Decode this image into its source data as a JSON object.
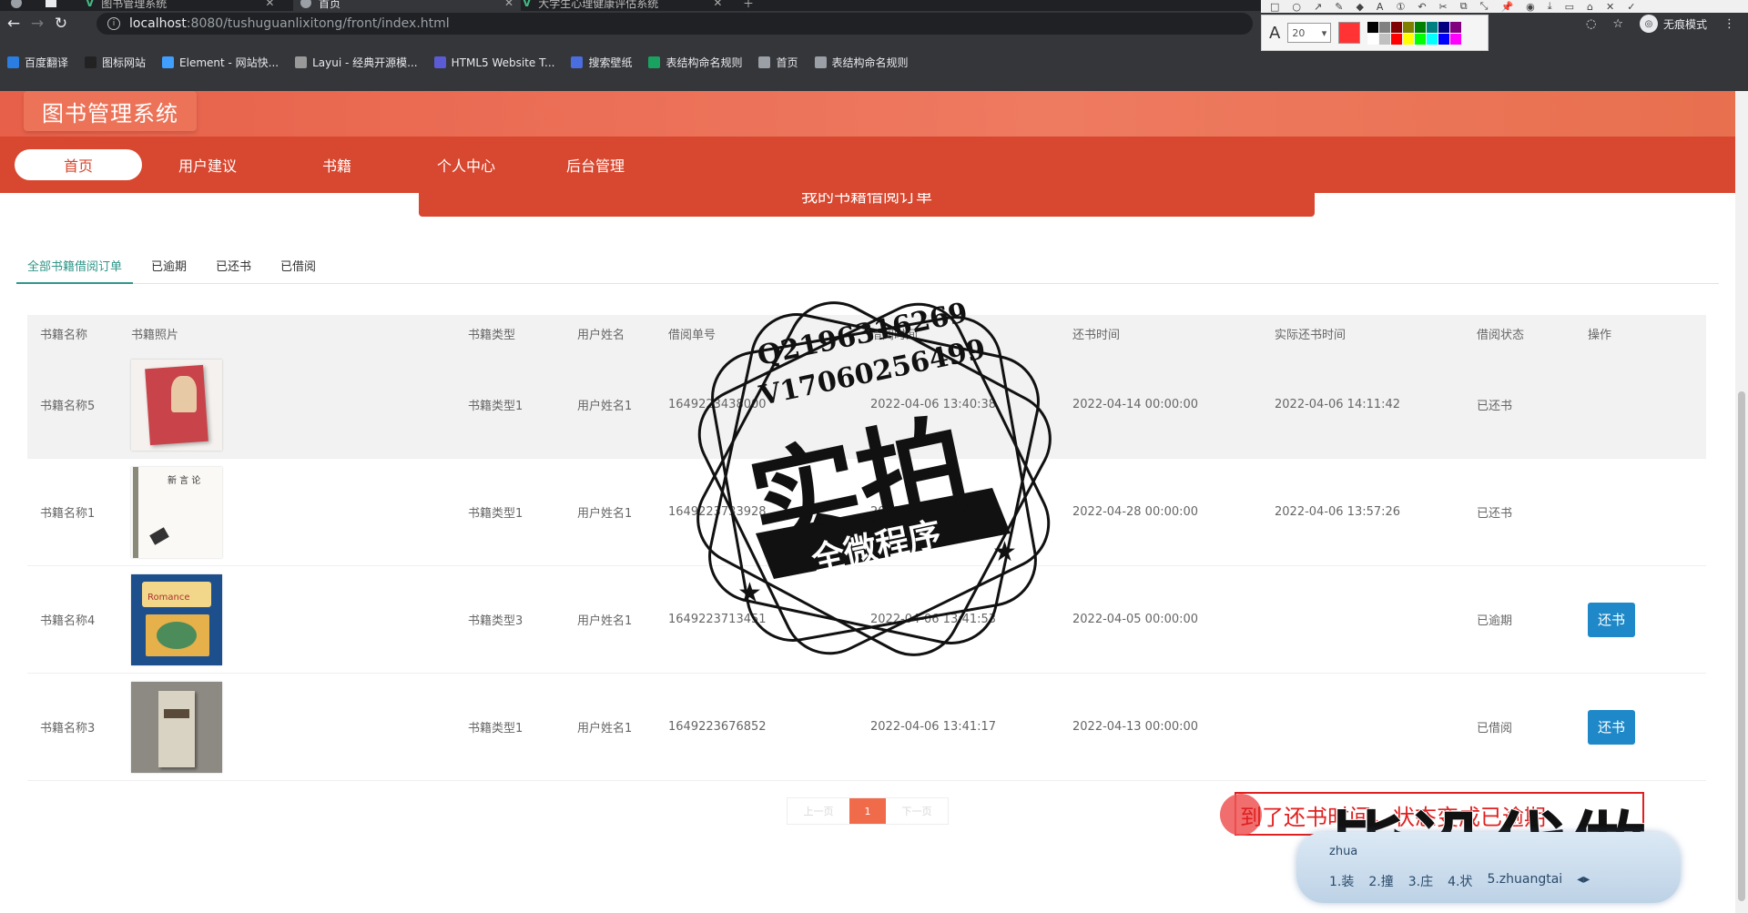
{
  "browser": {
    "tabs": [
      {
        "title": "图书管理系统",
        "active": false,
        "icon": "vue-icon"
      },
      {
        "title": "首页",
        "active": true,
        "icon": "globe-icon"
      },
      {
        "title": "大学生心理健康评估系统",
        "active": false,
        "icon": "vue-icon"
      }
    ],
    "url_host": "localhost",
    "url_path": ":8080/tushuguanlixitong/front/index.html",
    "incognito_label": "无痕模式",
    "bookmarks": [
      {
        "label": "百度翻译",
        "color": "#2a7de1"
      },
      {
        "label": "图标网站",
        "color": "#222222"
      },
      {
        "label": "Element - 网站快...",
        "color": "#409eff"
      },
      {
        "label": "Layui - 经典开源模...",
        "color": "#999999"
      },
      {
        "label": "HTML5 Website T...",
        "color": "#5b5bd6"
      },
      {
        "label": "搜索壁纸",
        "color": "#4a6ee0"
      },
      {
        "label": "表结构命名规则",
        "color": "#1aa260"
      },
      {
        "label": "首页",
        "color": "#9aa0a6"
      },
      {
        "label": "表结构命名规则",
        "color": "#9aa0a6"
      }
    ]
  },
  "annot_tool": {
    "font_size": "20",
    "current_color": "#ff3333",
    "palette": [
      "#000000",
      "#808080",
      "#800000",
      "#808000",
      "#008000",
      "#008080",
      "#000080",
      "#800080",
      "#ffffff",
      "#c0c0c0",
      "#ff0000",
      "#ffff00",
      "#00ff00",
      "#00ffff",
      "#0000ff",
      "#ff00ff"
    ]
  },
  "site": {
    "title": "图书管理系统",
    "nav": [
      {
        "label": "首页",
        "active": true
      },
      {
        "label": "用户建议",
        "active": false
      },
      {
        "label": "书籍",
        "active": false
      },
      {
        "label": "个人中心",
        "active": false
      },
      {
        "label": "后台管理",
        "active": false
      }
    ],
    "banner": "我的书籍借阅订单",
    "accent": "#d8472f"
  },
  "filter_tabs": [
    {
      "label": "全部书籍借阅订单",
      "active": true
    },
    {
      "label": "已逾期",
      "active": false
    },
    {
      "label": "已还书",
      "active": false
    },
    {
      "label": "已借阅",
      "active": false
    }
  ],
  "table": {
    "headers": [
      "书籍名称",
      "书籍照片",
      "书籍类型",
      "用户姓名",
      "借阅单号",
      "借阅时间",
      "还书时间",
      "实际还书时间",
      "借阅状态",
      "操作"
    ],
    "rows": [
      {
        "name": "书籍名称5",
        "type": "书籍类型1",
        "user": "用户姓名1",
        "order": "1649223438000",
        "borrow": "2022-04-06 13:40:38",
        "due": "2022-04-14 00:00:00",
        "actual": "2022-04-06 14:11:42",
        "status": "已还书",
        "action": "",
        "cover": "cover-red"
      },
      {
        "name": "书籍名称1",
        "type": "书籍类型1",
        "user": "用户姓名1",
        "order": "1649223733928",
        "borrow": "2022-04-06 13:42:14",
        "due": "2022-04-28 00:00:00",
        "actual": "2022-04-06 13:57:26",
        "status": "已还书",
        "action": "",
        "cover": "cover-white"
      },
      {
        "name": "书籍名称4",
        "type": "书籍类型3",
        "user": "用户姓名1",
        "order": "1649223713451",
        "borrow": "2022-04-06 13:41:53",
        "due": "2022-04-05 00:00:00",
        "actual": "",
        "status": "已逾期",
        "action": "还书",
        "cover": "cover-blue"
      },
      {
        "name": "书籍名称3",
        "type": "书籍类型1",
        "user": "用户姓名1",
        "order": "1649223676852",
        "borrow": "2022-04-06 13:41:17",
        "due": "2022-04-13 00:00:00",
        "actual": "",
        "status": "已借阅",
        "action": "还书",
        "cover": "cover-gray"
      }
    ]
  },
  "pagination": {
    "prev": "上一页",
    "current": "1",
    "next": "下一页"
  },
  "watermark": {
    "qq": "Q2196316269",
    "vx": "V17060256499",
    "main": "实拍",
    "ribbon": "全微程序"
  },
  "overlay": {
    "big": "毕设代做",
    "red_text": "到了还书时间，状态变成已逾期",
    "ime_pinyin": "zhua",
    "ime_candidates": [
      "1.装",
      "2.撞",
      "3.庄",
      "4.状",
      "5.zhuangtai"
    ]
  }
}
